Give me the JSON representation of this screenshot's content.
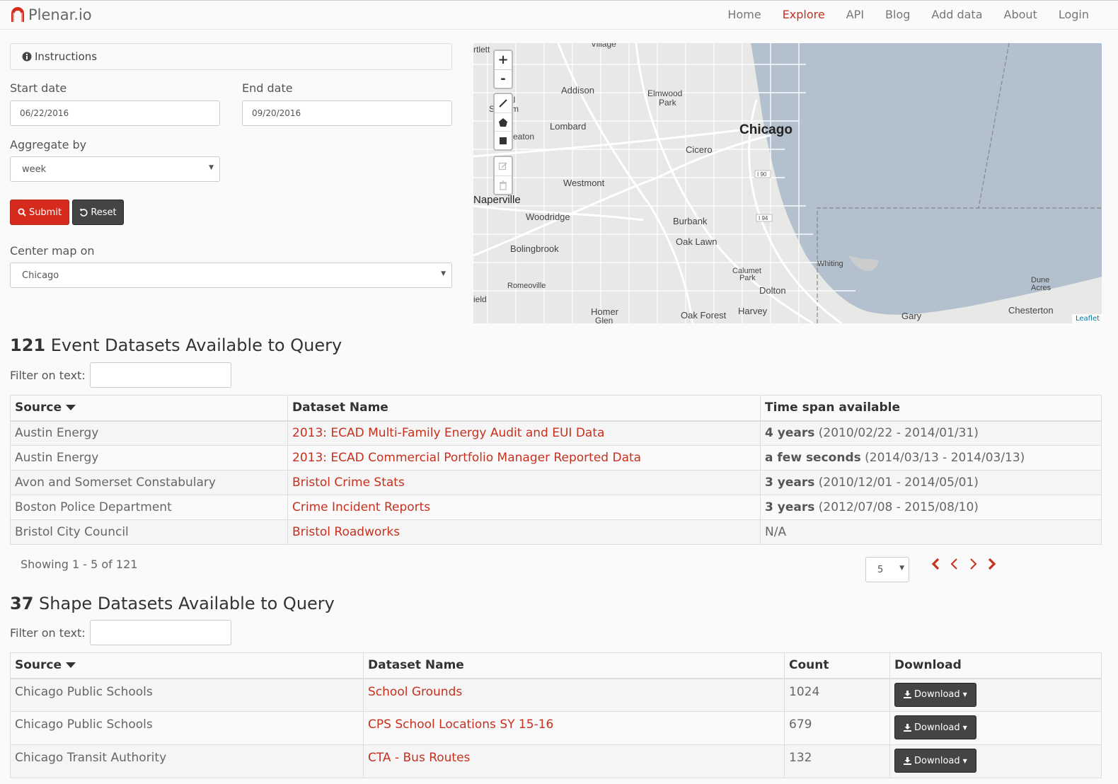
{
  "brand": {
    "name": "Plenar.io"
  },
  "nav": {
    "items": [
      "Home",
      "Explore",
      "API",
      "Blog",
      "Add data",
      "About",
      "Login"
    ],
    "active": "Explore"
  },
  "instructions": {
    "label": "Instructions"
  },
  "form": {
    "start_label": "Start date",
    "start_value": "06/22/2016",
    "end_label": "End date",
    "end_value": "09/20/2016",
    "aggregate_label": "Aggregate by",
    "aggregate_value": "week",
    "submit_label": "Submit",
    "reset_label": "Reset",
    "center_label": "Center map on",
    "center_value": "Chicago"
  },
  "map": {
    "zoom_in": "+",
    "zoom_out": "-",
    "attribution": "Leaflet",
    "labels": [
      "Village",
      "rtlett",
      "Addison",
      "Elmwood Park",
      "al",
      "S",
      "m",
      "Lombard",
      "eaton",
      "Chicago",
      "Cicero",
      "I 90",
      "Westmont",
      "Naperville",
      "Woodridge",
      "I 94",
      "Burbank",
      "Oak Lawn",
      "Bolingbrook",
      "Whiting",
      "Calumet Park",
      "Romeoville",
      "Dolton",
      "Dune Acres",
      "ield",
      "Homer Glen",
      "Oak Forest",
      "Harvey",
      "Gary",
      "Chesterton"
    ],
    "colors": {
      "water": "#b3c0ce",
      "land": "#e8e8e6",
      "roads": "#ffffff"
    }
  },
  "events": {
    "count": "121",
    "heading": "Event Datasets Available to Query",
    "filter_label": "Filter on text:",
    "columns": [
      "Source",
      "Dataset Name",
      "Time span available"
    ],
    "rows": [
      {
        "source": "Austin Energy",
        "name": "2013: ECAD Multi-Family Energy Audit and EUI Data",
        "span_bold": "4 years",
        "span_range": "(2010/02/22 - 2014/01/31)"
      },
      {
        "source": "Austin Energy",
        "name": "2013: ECAD Commercial Portfolio Manager Reported Data",
        "span_bold": "a few seconds",
        "span_range": "(2014/03/13 - 2014/03/13)"
      },
      {
        "source": "Avon and Somerset Constabulary",
        "name": "Bristol Crime Stats",
        "span_bold": "3 years",
        "span_range": "(2010/12/01 - 2014/05/01)"
      },
      {
        "source": "Boston Police Department",
        "name": "Crime Incident Reports",
        "span_bold": "3 years",
        "span_range": "(2012/07/08 - 2015/08/10)"
      },
      {
        "source": "Bristol City Council",
        "name": "Bristol Roadworks",
        "span_bold": "",
        "span_range": "N/A"
      }
    ],
    "showing": "Showing 1 - 5 of 121",
    "page_size": "5"
  },
  "shapes": {
    "count": "37",
    "heading": "Shape Datasets Available to Query",
    "filter_label": "Filter on text:",
    "columns": [
      "Source",
      "Dataset Name",
      "Count",
      "Download"
    ],
    "rows": [
      {
        "source": "Chicago Public Schools",
        "name": "School Grounds",
        "count": "1024",
        "download": "Download"
      },
      {
        "source": "Chicago Public Schools",
        "name": "CPS School Locations SY 15-16",
        "count": "679",
        "download": "Download"
      },
      {
        "source": "Chicago Transit Authority",
        "name": "CTA - Bus Routes",
        "count": "132",
        "download": "Download"
      }
    ]
  }
}
